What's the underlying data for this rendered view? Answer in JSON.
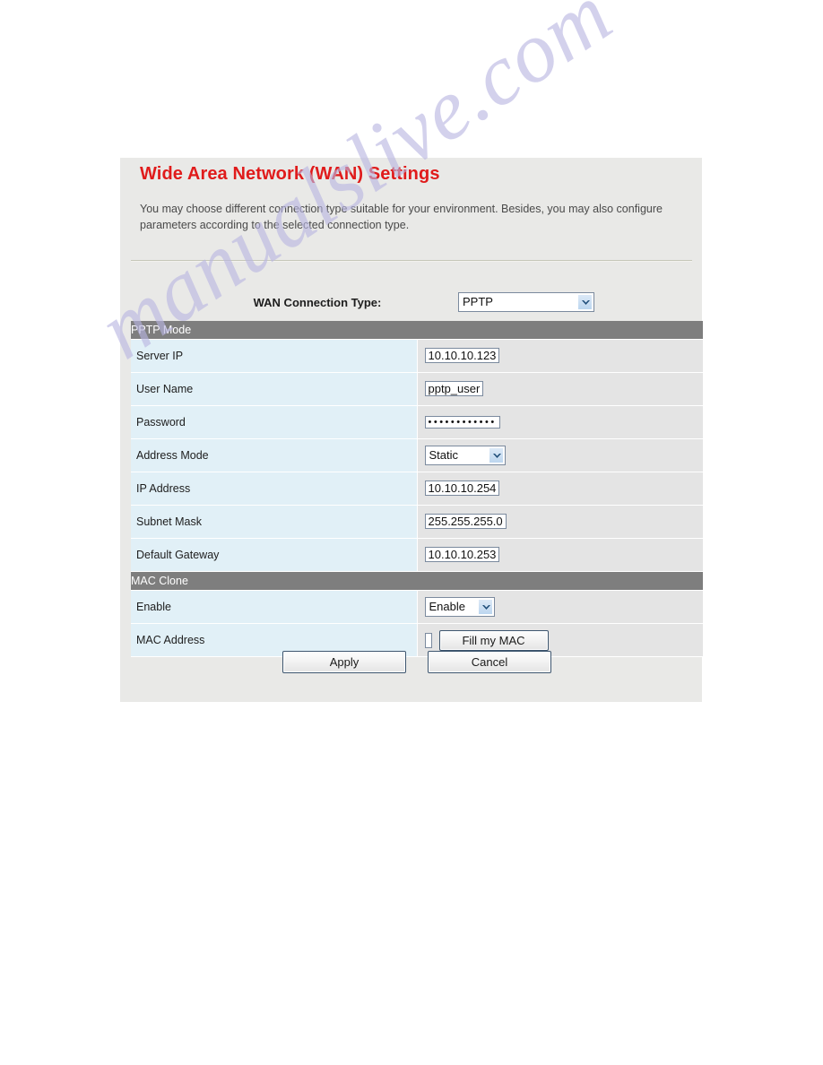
{
  "watermark": {
    "text": "manualslive.com",
    "color": "#b9b6e2"
  },
  "panel": {
    "title": "Wide Area Network (WAN) Settings",
    "title_color": "#e01b1b",
    "description": "You may choose different connection type suitable for your environment. Besides, you may also configure parameters according to the selected connection type."
  },
  "connection_type": {
    "label": "WAN Connection Type:",
    "selected": "PPTP",
    "arrow_icon": "chevron-down-icon"
  },
  "sections": {
    "pptp_mode": {
      "header": "PPTP Mode",
      "rows": {
        "server_ip": {
          "label": "Server IP",
          "value": "10.10.10.123"
        },
        "user_name": {
          "label": "User Name",
          "value": "pptp_user"
        },
        "password": {
          "label": "Password",
          "value": "************"
        },
        "address_mode": {
          "label": "Address Mode",
          "value": "Static"
        },
        "ip_address": {
          "label": "IP Address",
          "value": "10.10.10.254"
        },
        "subnet_mask": {
          "label": "Subnet Mask",
          "value": "255.255.255.0"
        },
        "default_gateway": {
          "label": "Default Gateway",
          "value": "10.10.10.253"
        }
      }
    },
    "mac_clone": {
      "header": "MAC Clone",
      "rows": {
        "enable": {
          "label": "Enable",
          "value": "Enable"
        },
        "mac_address": {
          "label": "MAC Address",
          "value": "",
          "placeholder": ""
        }
      },
      "fill_my_mac_label": "Fill my MAC"
    }
  },
  "actions": {
    "apply_label": "Apply",
    "cancel_label": "Cancel"
  },
  "colors": {
    "panel_bg": "#e9e9e7",
    "section_header_bg": "#7e7e7e",
    "label_cell_bg": "#e1f0f7",
    "value_cell_bg": "#e4e4e4",
    "title_red": "#e01b1b"
  }
}
